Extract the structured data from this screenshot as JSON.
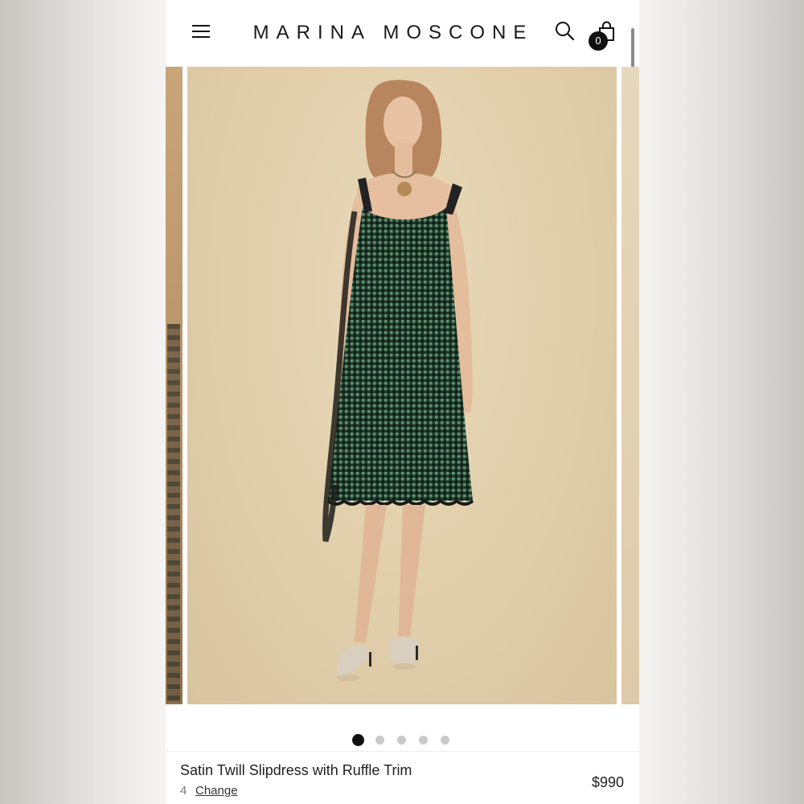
{
  "header": {
    "brand": "MARINA MOSCONE",
    "menu_icon": "hamburger-menu-icon",
    "search_icon": "search-icon",
    "bag_icon": "shopping-bag-icon",
    "bag_count": "0"
  },
  "carousel": {
    "slide_count": 5,
    "active_slide": 1
  },
  "product": {
    "title": "Satin Twill Slipdress with Ruffle Trim",
    "quantity": "4",
    "change_label": "Change",
    "price": "$990"
  },
  "colors": {
    "background": "#ffffff",
    "text": "#1a1a1a",
    "dot_active": "#111111",
    "dot_inactive": "#c9c9c9"
  }
}
